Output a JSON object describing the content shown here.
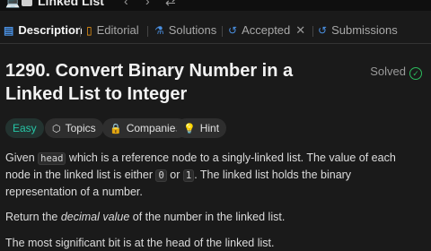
{
  "app": {
    "tab_title": "Linked List"
  },
  "tabs": [
    {
      "label": "Description",
      "icon": "document-icon"
    },
    {
      "label": "Editorial",
      "icon": "book-icon"
    },
    {
      "label": "Solutions",
      "icon": "flask-icon"
    },
    {
      "label": "Accepted",
      "icon": "undo-icon"
    },
    {
      "label": "Submissions",
      "icon": "history-icon"
    }
  ],
  "problem": {
    "title": "1290. Convert Binary Number in a Linked List to Integer",
    "status": "Solved",
    "status_color": "#2cbb5d"
  },
  "chips": [
    {
      "label": "Easy"
    },
    {
      "label": "Topics",
      "icon": "tag-icon"
    },
    {
      "label": "Companies",
      "icon": "lock-icon"
    },
    {
      "label": "Hint",
      "icon": "bulb-icon"
    }
  ],
  "description": {
    "p1_a": "Given ",
    "p1_code1": "head",
    "p1_b": " which is a reference node to a singly-linked list. The value of each node in the linked list is either ",
    "p1_code2": "0",
    "p1_c": " or ",
    "p1_code3": "1",
    "p1_d": ". The linked list holds the binary representation of a number.",
    "p2_a": "Return the ",
    "p2_em": "decimal value",
    "p2_b": " of the number in the linked list.",
    "p3": "The most significant bit is at the head of the linked list."
  },
  "colors": {
    "accent": "#ffa116",
    "easy": "#26c6a6",
    "link": "#4a90e2"
  }
}
